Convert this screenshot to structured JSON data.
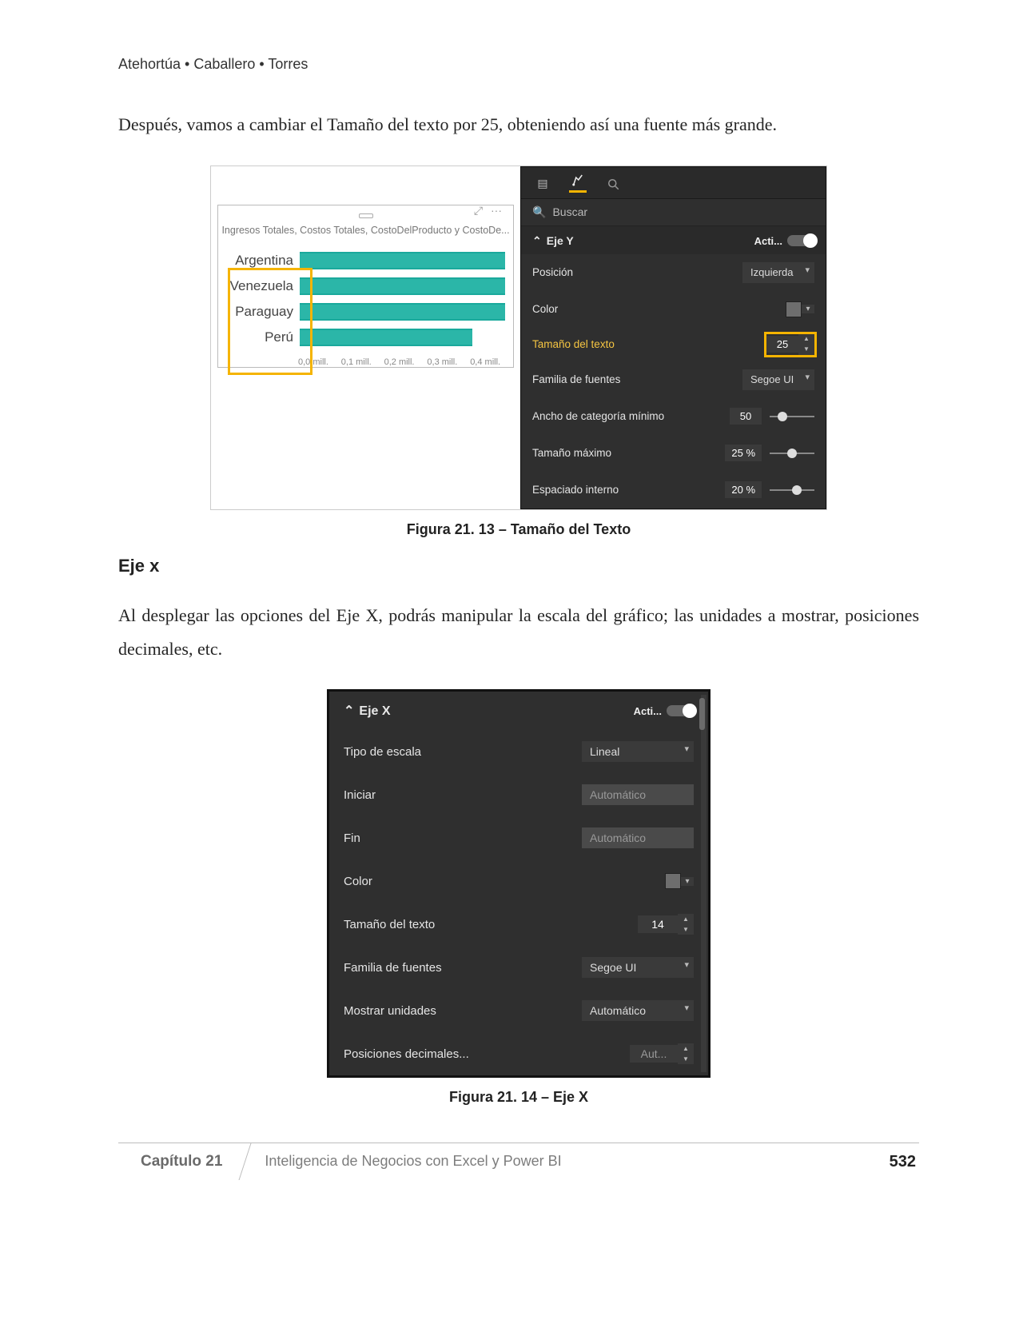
{
  "header": {
    "authors": "Atehortúa • Caballero • Torres"
  },
  "para1": "Después, vamos a cambiar el Tamaño del texto por 25, obteniendo así una fuente más grande.",
  "fig1": {
    "chart_title": "Ingresos Totales, Costos Totales, CostoDelProducto y CostoDe...",
    "focus_icon": "⤢",
    "more_icon": "···",
    "categories": [
      "Argentina",
      "Venezuela",
      "Paraguay",
      "Perú"
    ],
    "xticks": [
      "0,0 mill.",
      "0,1 mill.",
      "0,2 mill.",
      "0,3 mill.",
      "0,4 mill."
    ],
    "chart_data": {
      "type": "bar",
      "orientation": "horizontal",
      "categories": [
        "Argentina",
        "Venezuela",
        "Paraguay",
        "Perú"
      ],
      "series": [
        {
          "name": "Ingresos Totales",
          "values": [
            0.4,
            0.4,
            0.4,
            0.35
          ]
        },
        {
          "name": "Costos Totales",
          "values": [
            0.4,
            0.4,
            0.4,
            0.35
          ]
        }
      ],
      "xlabel": "",
      "ylabel": "",
      "xticks": [
        "0,0 mill.",
        "0,1 mill.",
        "0,2 mill.",
        "0,3 mill.",
        "0,4 mill."
      ],
      "xlim": [
        0.0,
        0.4
      ],
      "units": "mill."
    },
    "panel": {
      "search": "Buscar",
      "section": "Eje Y",
      "toggle_label": "Acti...",
      "rows": {
        "posicion": {
          "label": "Posición",
          "value": "Izquierda"
        },
        "color": {
          "label": "Color"
        },
        "tamano": {
          "label": "Tamaño del texto",
          "value": "25"
        },
        "familia": {
          "label": "Familia de fuentes",
          "value": "Segoe UI"
        },
        "ancho": {
          "label": "Ancho de categoría mínimo",
          "value": "50"
        },
        "max": {
          "label": "Tamaño máximo",
          "value": "25",
          "unit": "%"
        },
        "espaciado": {
          "label": "Espaciado interno",
          "value": "20",
          "unit": "%"
        }
      }
    },
    "caption": "Figura 21. 13 – Tamaño del Texto"
  },
  "heading_ejex": "Eje x",
  "para2": "Al desplegar las opciones del Eje X, podrás manipular la escala del gráfico; las unidades a mostrar, posiciones decimales, etc.",
  "fig2": {
    "panel": {
      "section": "Eje X",
      "toggle_label": "Acti...",
      "rows": {
        "tipo": {
          "label": "Tipo de escala",
          "value": "Lineal"
        },
        "iniciar": {
          "label": "Iniciar",
          "value": "Automático"
        },
        "fin": {
          "label": "Fin",
          "value": "Automático"
        },
        "color": {
          "label": "Color"
        },
        "tamano": {
          "label": "Tamaño del texto",
          "value": "14"
        },
        "familia": {
          "label": "Familia de fuentes",
          "value": "Segoe UI"
        },
        "unidades": {
          "label": "Mostrar unidades",
          "value": "Automático"
        },
        "decimales": {
          "label": "Posiciones decimales...",
          "value": "Aut..."
        }
      }
    },
    "caption": "Figura 21. 14 – Eje X"
  },
  "footer": {
    "chapter": "Capítulo 21",
    "title": "Inteligencia de Negocios con Excel y Power BI",
    "page": "532"
  }
}
